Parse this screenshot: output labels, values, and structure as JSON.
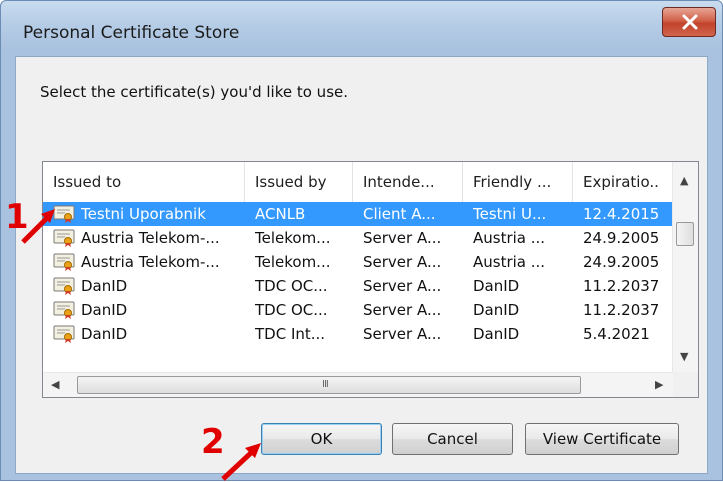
{
  "window": {
    "title": "Personal Certificate Store"
  },
  "dialog": {
    "prompt": "Select the certificate(s) you'd like to use."
  },
  "table": {
    "columns": [
      "Issued to",
      "Issued by",
      "Intende...",
      "Friendly ...",
      "Expiratio.."
    ],
    "rows": [
      {
        "issued_to": "Testni Uporabnik",
        "issued_by": "ACNLB",
        "intended": "Client A...",
        "friendly": "Testni U...",
        "expiration": "12.4.2015",
        "selected": true
      },
      {
        "issued_to": "Austria Telekom-...",
        "issued_by": "Telekom...",
        "intended": "Server A...",
        "friendly": "Austria ...",
        "expiration": "24.9.2005"
      },
      {
        "issued_to": "Austria Telekom-...",
        "issued_by": "Telekom...",
        "intended": "Server A...",
        "friendly": "Austria ...",
        "expiration": "24.9.2005"
      },
      {
        "issued_to": "DanID",
        "issued_by": "TDC OC...",
        "intended": "Server A...",
        "friendly": "DanID",
        "expiration": "11.2.2037"
      },
      {
        "issued_to": "DanID",
        "issued_by": "TDC OC...",
        "intended": "Server A...",
        "friendly": "DanID",
        "expiration": "11.2.2037"
      },
      {
        "issued_to": "DanID",
        "issued_by": "TDC Int...",
        "intended": "Server A...",
        "friendly": "DanID",
        "expiration": "5.4.2021"
      }
    ],
    "hscroll_grip": "III"
  },
  "buttons": {
    "ok": "OK",
    "cancel": "Cancel",
    "view": "View Certificate"
  },
  "annotations": {
    "step1": "1",
    "step2": "2"
  },
  "colors": {
    "selection": "#3399ff",
    "annotation": "#e00000"
  },
  "icons": {
    "close": "close-icon",
    "certificate": "certificate-icon"
  }
}
